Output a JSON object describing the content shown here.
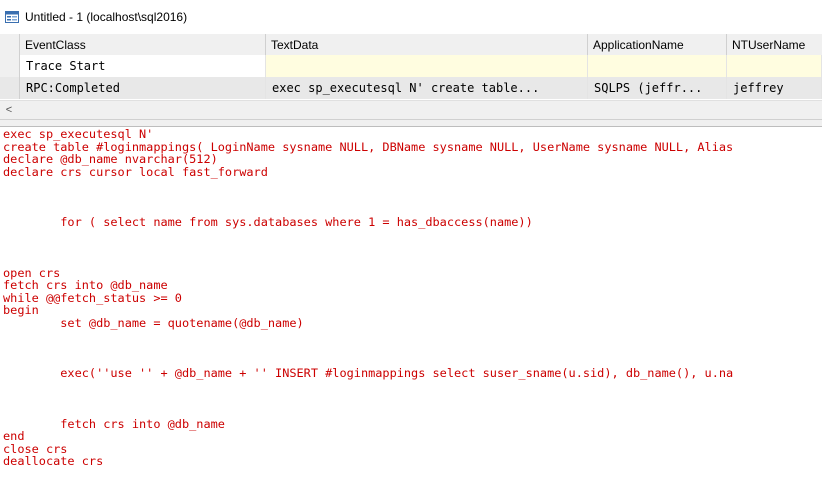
{
  "window": {
    "title": "Untitled - 1 (localhost\\sql2016)",
    "icon": "profiler-trace-icon"
  },
  "grid": {
    "columns": [
      "EventClass",
      "TextData",
      "ApplicationName",
      "NTUserName"
    ],
    "rows": [
      {
        "event_class": "Trace Start",
        "text_data": "",
        "application_name": "",
        "nt_user_name": ""
      },
      {
        "event_class": "RPC:Completed",
        "text_data": "exec sp_executesql N'  create table...",
        "application_name": "SQLPS (jeffr...",
        "nt_user_name": "jeffrey"
      }
    ]
  },
  "scrollbar": {
    "left_arrow": "<"
  },
  "text_pane": {
    "lines": [
      "exec sp_executesql N'",
      "create table #loginmappings( LoginName sysname NULL, DBName sysname NULL, UserName sysname NULL, Alias",
      "declare @db_name nvarchar(512)",
      "declare crs cursor local fast_forward",
      "",
      "",
      "",
      "        for ( select name from sys.databases where 1 = has_dbaccess(name))",
      "",
      "",
      "",
      "open crs",
      "fetch crs into @db_name",
      "while @@fetch_status >= 0",
      "begin",
      "        set @db_name = quotename(@db_name)",
      "",
      "",
      "",
      "        exec(''use '' + @db_name + '' INSERT #loginmappings select suser_sname(u.sid), db_name(), u.na",
      "",
      "",
      "",
      "        fetch crs into @db_name",
      "end",
      "close crs",
      "deallocate crs"
    ]
  }
}
